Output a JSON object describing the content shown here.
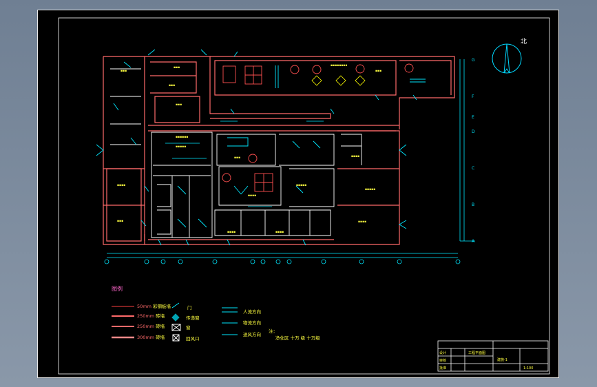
{
  "drawing": {
    "north_label": "北",
    "legend_title": "图例",
    "legend_walls": [
      {
        "size": "50mm",
        "desc": "彩钢板墙"
      },
      {
        "size": "250mm",
        "desc": "砖墙"
      },
      {
        "size": "250mm",
        "desc": "砖墙"
      },
      {
        "size": "300mm",
        "desc": "砖墙"
      }
    ],
    "legend_symbols": [
      "门",
      "传递窗",
      "窗",
      "回风口"
    ],
    "legend_flows": [
      "人流方向",
      "物流方向",
      "送风方向"
    ],
    "legend_note": "注：",
    "legend_note_text": "净化区 十万 级 十万级",
    "row_labels": [
      "G",
      "F",
      "E",
      "D",
      "C",
      "B",
      "A"
    ],
    "title_block": {
      "title": "工程平面图",
      "sheet": "建施-1",
      "scale": "1:100",
      "rows": [
        "设计",
        "审核",
        "批准"
      ]
    }
  }
}
